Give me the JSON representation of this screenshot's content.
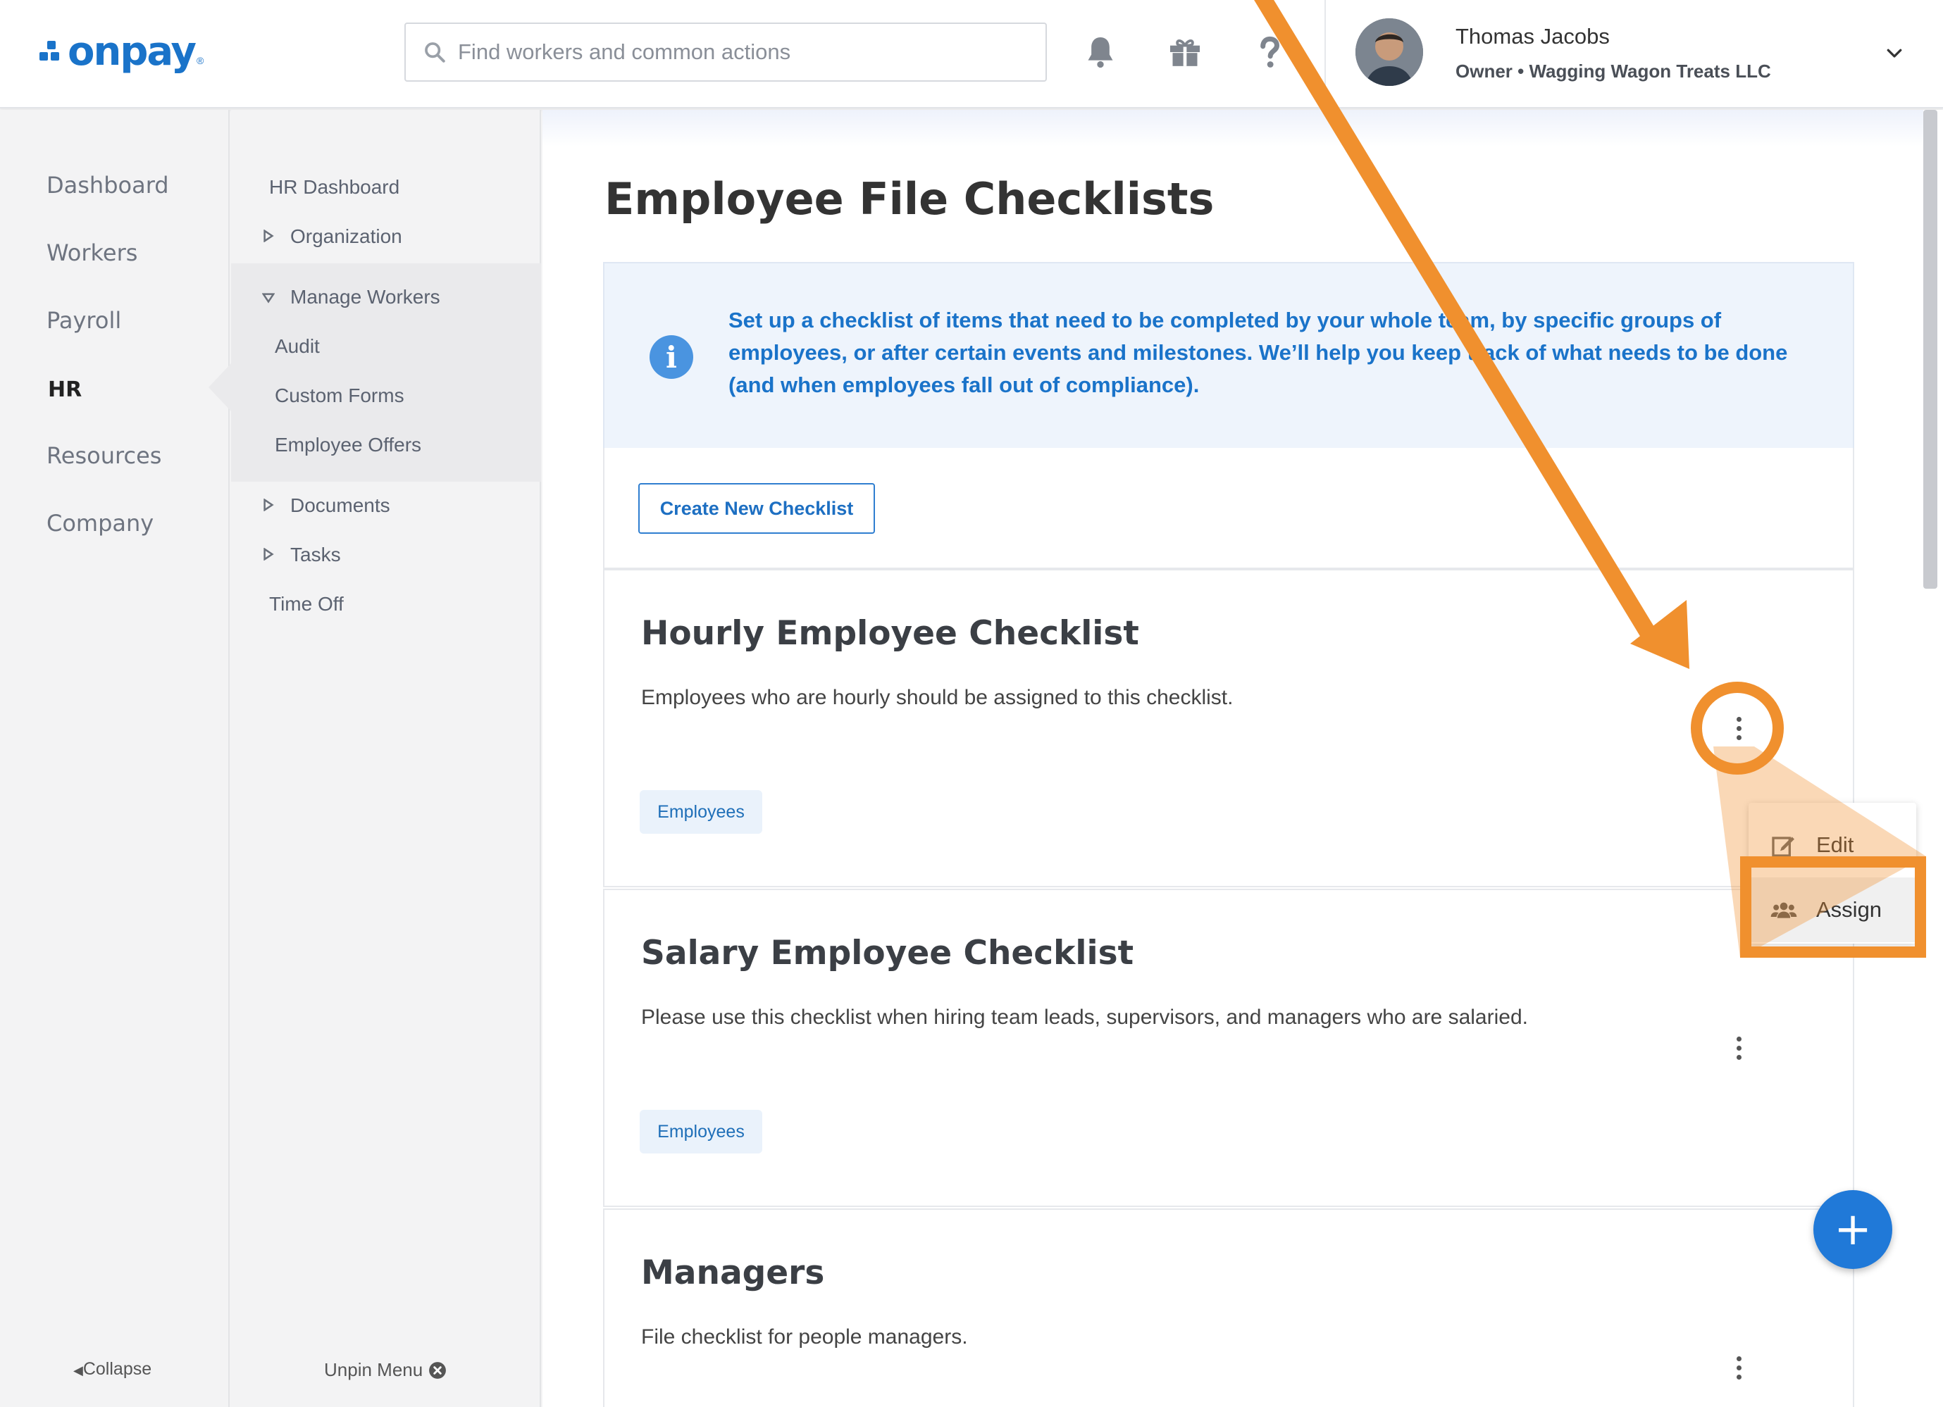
{
  "brand": {
    "logo_text": "onpay",
    "registered": "®",
    "accent": "#1a73c9"
  },
  "search": {
    "placeholder": "Find workers and common actions"
  },
  "header_icons": [
    "bell-icon",
    "gift-icon",
    "help-icon"
  ],
  "user": {
    "name": "Thomas Jacobs",
    "role": "Owner • Wagging Wagon Treats LLC"
  },
  "primary_nav": {
    "items": [
      "Dashboard",
      "Workers",
      "Payroll",
      "HR",
      "Resources",
      "Company"
    ],
    "active": "HR",
    "collapse_label": "Collapse"
  },
  "secondary_nav": {
    "hr_dashboard": "HR Dashboard",
    "organization": "Organization",
    "manage_workers": "Manage Workers",
    "audit": "Audit",
    "custom_forms": "Custom Forms",
    "employee_offers": "Employee Offers",
    "documents": "Documents",
    "tasks": "Tasks",
    "time_off": "Time Off",
    "unpin_label": "Unpin Menu"
  },
  "page": {
    "title": "Employee File Checklists",
    "info_text": "Set up a checklist of items that need to be completed by your whole team, by specific groups of employees, or after certain events and milestones. We’ll help you keep track of what needs to be done (and when employees fall out of compliance).",
    "create_button": "Create New Checklist"
  },
  "checklists": [
    {
      "title": "Hourly Employee Checklist",
      "description": "Employees who are hourly should be assigned to this checklist.",
      "tag": "Employees"
    },
    {
      "title": "Salary Employee Checklist",
      "description": "Please use this checklist when hiring team leads, supervisors, and managers who are salaried.",
      "tag": "Employees"
    },
    {
      "title": "Managers",
      "description": "File checklist for people managers."
    }
  ],
  "menu": {
    "edit": "Edit",
    "assign": "Assign"
  },
  "fab_label": "+",
  "annotation_color": "#f0902e"
}
